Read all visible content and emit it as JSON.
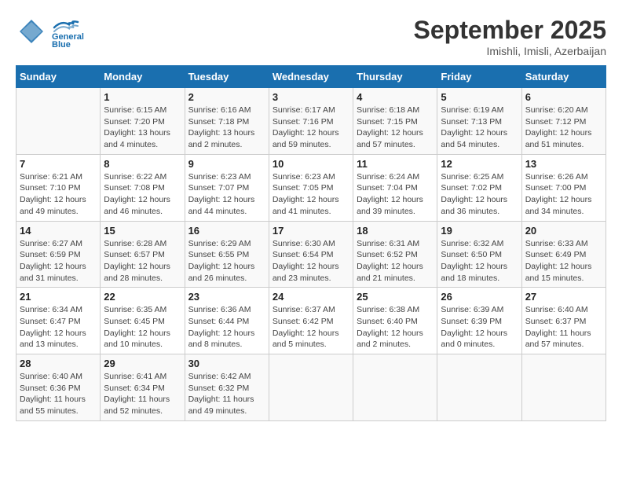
{
  "header": {
    "logo_line1": "General",
    "logo_line2": "Blue",
    "month": "September 2025",
    "location": "Imishli, Imisli, Azerbaijan"
  },
  "weekdays": [
    "Sunday",
    "Monday",
    "Tuesday",
    "Wednesday",
    "Thursday",
    "Friday",
    "Saturday"
  ],
  "weeks": [
    [
      {
        "day": "",
        "info": ""
      },
      {
        "day": "1",
        "info": "Sunrise: 6:15 AM\nSunset: 7:20 PM\nDaylight: 13 hours\nand 4 minutes."
      },
      {
        "day": "2",
        "info": "Sunrise: 6:16 AM\nSunset: 7:18 PM\nDaylight: 13 hours\nand 2 minutes."
      },
      {
        "day": "3",
        "info": "Sunrise: 6:17 AM\nSunset: 7:16 PM\nDaylight: 12 hours\nand 59 minutes."
      },
      {
        "day": "4",
        "info": "Sunrise: 6:18 AM\nSunset: 7:15 PM\nDaylight: 12 hours\nand 57 minutes."
      },
      {
        "day": "5",
        "info": "Sunrise: 6:19 AM\nSunset: 7:13 PM\nDaylight: 12 hours\nand 54 minutes."
      },
      {
        "day": "6",
        "info": "Sunrise: 6:20 AM\nSunset: 7:12 PM\nDaylight: 12 hours\nand 51 minutes."
      }
    ],
    [
      {
        "day": "7",
        "info": "Sunrise: 6:21 AM\nSunset: 7:10 PM\nDaylight: 12 hours\nand 49 minutes."
      },
      {
        "day": "8",
        "info": "Sunrise: 6:22 AM\nSunset: 7:08 PM\nDaylight: 12 hours\nand 46 minutes."
      },
      {
        "day": "9",
        "info": "Sunrise: 6:23 AM\nSunset: 7:07 PM\nDaylight: 12 hours\nand 44 minutes."
      },
      {
        "day": "10",
        "info": "Sunrise: 6:23 AM\nSunset: 7:05 PM\nDaylight: 12 hours\nand 41 minutes."
      },
      {
        "day": "11",
        "info": "Sunrise: 6:24 AM\nSunset: 7:04 PM\nDaylight: 12 hours\nand 39 minutes."
      },
      {
        "day": "12",
        "info": "Sunrise: 6:25 AM\nSunset: 7:02 PM\nDaylight: 12 hours\nand 36 minutes."
      },
      {
        "day": "13",
        "info": "Sunrise: 6:26 AM\nSunset: 7:00 PM\nDaylight: 12 hours\nand 34 minutes."
      }
    ],
    [
      {
        "day": "14",
        "info": "Sunrise: 6:27 AM\nSunset: 6:59 PM\nDaylight: 12 hours\nand 31 minutes."
      },
      {
        "day": "15",
        "info": "Sunrise: 6:28 AM\nSunset: 6:57 PM\nDaylight: 12 hours\nand 28 minutes."
      },
      {
        "day": "16",
        "info": "Sunrise: 6:29 AM\nSunset: 6:55 PM\nDaylight: 12 hours\nand 26 minutes."
      },
      {
        "day": "17",
        "info": "Sunrise: 6:30 AM\nSunset: 6:54 PM\nDaylight: 12 hours\nand 23 minutes."
      },
      {
        "day": "18",
        "info": "Sunrise: 6:31 AM\nSunset: 6:52 PM\nDaylight: 12 hours\nand 21 minutes."
      },
      {
        "day": "19",
        "info": "Sunrise: 6:32 AM\nSunset: 6:50 PM\nDaylight: 12 hours\nand 18 minutes."
      },
      {
        "day": "20",
        "info": "Sunrise: 6:33 AM\nSunset: 6:49 PM\nDaylight: 12 hours\nand 15 minutes."
      }
    ],
    [
      {
        "day": "21",
        "info": "Sunrise: 6:34 AM\nSunset: 6:47 PM\nDaylight: 12 hours\nand 13 minutes."
      },
      {
        "day": "22",
        "info": "Sunrise: 6:35 AM\nSunset: 6:45 PM\nDaylight: 12 hours\nand 10 minutes."
      },
      {
        "day": "23",
        "info": "Sunrise: 6:36 AM\nSunset: 6:44 PM\nDaylight: 12 hours\nand 8 minutes."
      },
      {
        "day": "24",
        "info": "Sunrise: 6:37 AM\nSunset: 6:42 PM\nDaylight: 12 hours\nand 5 minutes."
      },
      {
        "day": "25",
        "info": "Sunrise: 6:38 AM\nSunset: 6:40 PM\nDaylight: 12 hours\nand 2 minutes."
      },
      {
        "day": "26",
        "info": "Sunrise: 6:39 AM\nSunset: 6:39 PM\nDaylight: 12 hours\nand 0 minutes."
      },
      {
        "day": "27",
        "info": "Sunrise: 6:40 AM\nSunset: 6:37 PM\nDaylight: 11 hours\nand 57 minutes."
      }
    ],
    [
      {
        "day": "28",
        "info": "Sunrise: 6:40 AM\nSunset: 6:36 PM\nDaylight: 11 hours\nand 55 minutes."
      },
      {
        "day": "29",
        "info": "Sunrise: 6:41 AM\nSunset: 6:34 PM\nDaylight: 11 hours\nand 52 minutes."
      },
      {
        "day": "30",
        "info": "Sunrise: 6:42 AM\nSunset: 6:32 PM\nDaylight: 11 hours\nand 49 minutes."
      },
      {
        "day": "",
        "info": ""
      },
      {
        "day": "",
        "info": ""
      },
      {
        "day": "",
        "info": ""
      },
      {
        "day": "",
        "info": ""
      }
    ]
  ]
}
